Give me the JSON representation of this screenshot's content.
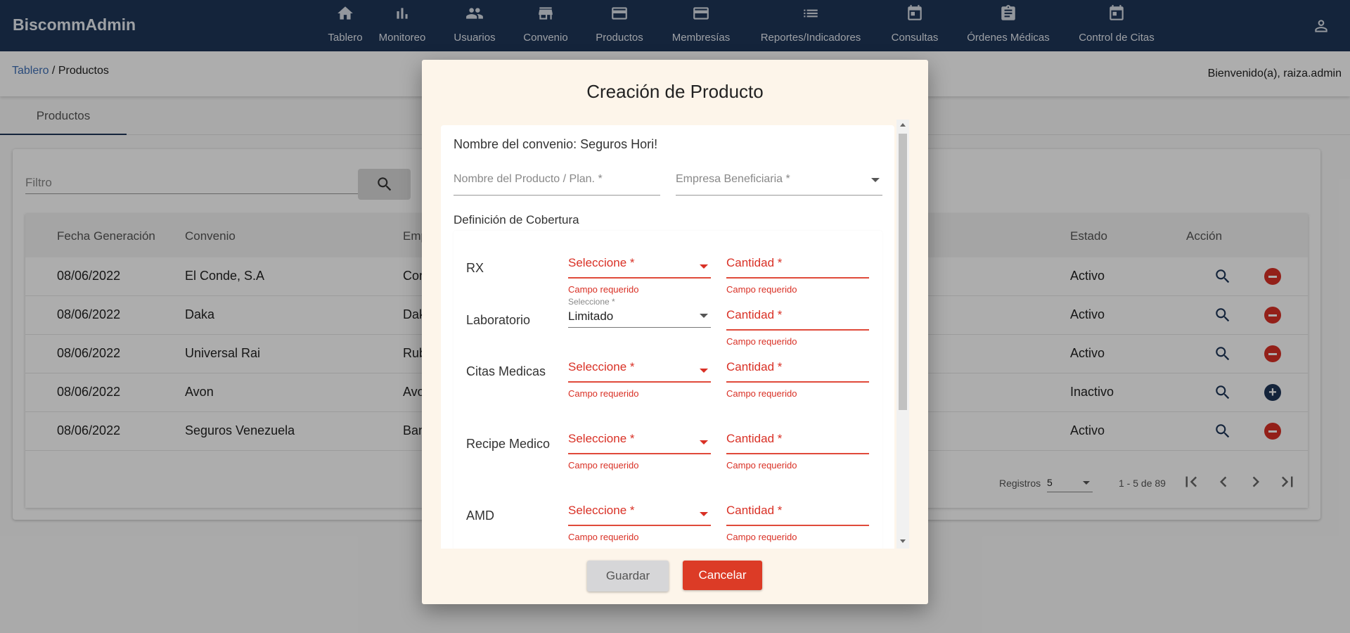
{
  "app": {
    "brand": "BiscommAdmin"
  },
  "nav": [
    {
      "label": "Tablero",
      "icon": "home-icon"
    },
    {
      "label": "Monitoreo",
      "icon": "bar-chart-icon"
    },
    {
      "label": "Usuarios",
      "icon": "people-icon"
    },
    {
      "label": "Convenio",
      "icon": "store-icon"
    },
    {
      "label": "Productos",
      "icon": "credit-card-icon"
    },
    {
      "label": "Membresías",
      "icon": "credit-card-icon"
    },
    {
      "label": "Reportes/Indicadores",
      "icon": "list-icon"
    },
    {
      "label": "Consultas",
      "icon": "calendar-icon"
    },
    {
      "label": "Órdenes Médicas",
      "icon": "clipboard-icon"
    },
    {
      "label": "Control de Citas",
      "icon": "calendar-icon"
    }
  ],
  "breadcrumb": {
    "link": "Tablero",
    "separator": " / ",
    "current": "Productos"
  },
  "welcome": "Bienvenido(a), raiza.admin",
  "tabs": [
    {
      "label": "Productos"
    }
  ],
  "filter": {
    "placeholder": "Filtro"
  },
  "table": {
    "headers": [
      "Fecha Generación",
      "Convenio",
      "Empr",
      "Estado",
      "Acción"
    ],
    "rows": [
      {
        "fecha": "08/06/2022",
        "convenio": "El Conde, S.A",
        "empresa": "Cons",
        "estado": "Activo",
        "toggle": "remove"
      },
      {
        "fecha": "08/06/2022",
        "convenio": "Daka",
        "empresa": "Dakit",
        "estado": "Activo",
        "toggle": "remove"
      },
      {
        "fecha": "08/06/2022",
        "convenio": "Universal Rai",
        "empresa": "Rubb",
        "estado": "Activo",
        "toggle": "remove"
      },
      {
        "fecha": "08/06/2022",
        "convenio": "Avon",
        "empresa": "Avon",
        "estado": "Inactivo",
        "toggle": "add"
      },
      {
        "fecha": "08/06/2022",
        "convenio": "Seguros Venezuela",
        "empresa": "Banc",
        "estado": "Activo",
        "toggle": "remove"
      }
    ]
  },
  "pager": {
    "label": "Registros",
    "page_size": "5",
    "range": "1 - 5 de 89"
  },
  "modal": {
    "title": "Creación de Producto",
    "convenio": "Nombre del convenio: Seguros Hori!",
    "producto_placeholder": "Nombre del Producto / Plan. *",
    "empresa_placeholder": "Empresa Beneficiaria *",
    "cobertura_title": "Definición de Cobertura",
    "coverage": [
      {
        "label": "RX",
        "select": "Seleccione *",
        "qty": "Cantidad *",
        "error_select": "Campo requerido",
        "error_qty": "Campo requerido"
      },
      {
        "label": "Laboratorio",
        "select_float": "Seleccione *",
        "select_value": "Limitado",
        "qty": "Cantidad *",
        "error_qty": "Campo requerido"
      },
      {
        "label": "Citas Medicas",
        "select": "Seleccione *",
        "qty": "Cantidad *",
        "error_select": "Campo requerido",
        "error_qty": "Campo requerido"
      },
      {
        "label": "Recipe Medico",
        "select": "Seleccione *",
        "qty": "Cantidad *",
        "error_select": "Campo requerido",
        "error_qty": "Campo requerido"
      },
      {
        "label": "AMD",
        "select": "Seleccione *",
        "qty": "Cantidad *",
        "error_select": "Campo requerido",
        "error_qty": "Campo requerido"
      }
    ],
    "save": "Guardar",
    "cancel": "Cancelar"
  },
  "colors": {
    "nav_bg": "#1e3558",
    "error": "#d93025",
    "cancel": "#dc3b26",
    "modal_bg": "#fdf5ea"
  }
}
